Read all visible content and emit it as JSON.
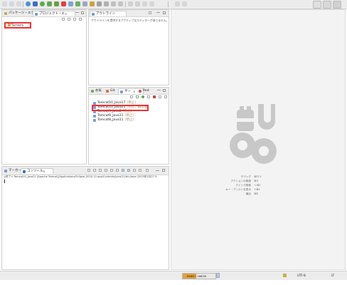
{
  "toolbar": {
    "icons": [
      "new-icon",
      "save-icon",
      "print-icon",
      "debug-icon",
      "run-icon",
      "external-tools-icon",
      "new-server-icon",
      "search-icon",
      "back-icon",
      "forward-icon"
    ]
  },
  "left_panel": {
    "tabs": [
      {
        "label": "パッケージ・エク"
      },
      {
        "label": "プロジェクト・エ"
      }
    ],
    "tab_close": "✕",
    "tree_item": "Servers"
  },
  "outline_panel": {
    "tab_label": "アウトライン",
    "message": "アウトラインを提供するアクティブなエディターがありません。"
  },
  "servers_panel": {
    "tabs": [
      {
        "label": "お気"
      },
      {
        "label": "Git"
      },
      {
        "label": "サー"
      },
      {
        "label": "Red"
      }
    ],
    "rows": [
      {
        "name": "Tomcat10_Java17",
        "status": "[停止]"
      },
      {
        "name": "Tomcat10_Java21",
        "status": "[停止、再公開]"
      },
      {
        "name": "Tomcat9_Java8",
        "status": "[停止]"
      },
      {
        "name": "Tomcat9_Java11",
        "status": "[停止]"
      },
      {
        "name": "Tomcat8_Java11",
        "status": "[停止]"
      }
    ]
  },
  "console_panel": {
    "tabs": [
      {
        "label": "マーカー"
      },
      {
        "label": "コンソール"
      }
    ],
    "tab_close": "✕",
    "console_text": "<終了> Tomcat10_Java21 [Apache Tomcat]/Applications/Eclipse_2024-12.app/Contents/java/21/bin/java  (2025年2月27 9"
  },
  "editor_area": {
    "properties": [
      {
        "label": "デバッグ",
        "value": "⌘F11"
      },
      {
        "label": "アクションの検索",
        "value": "⌘3"
      },
      {
        "label": "クイック検索",
        "value": "⌥⌘I"
      },
      {
        "label": "キー・アシストを表示",
        "value": "⇧⌘L"
      },
      {
        "label": "最近",
        "value": "⌘E"
      }
    ]
  },
  "status_bar": {
    "memory": "696M / 1682M",
    "encoding": "UTF-8",
    "line_ending": "LT"
  }
}
